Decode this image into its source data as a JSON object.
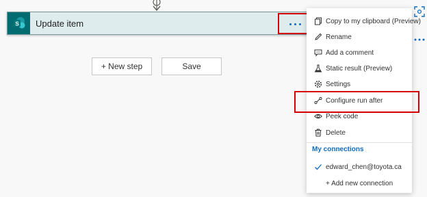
{
  "card": {
    "title": "Update item"
  },
  "buttons": {
    "new_step": "+ New step",
    "save": "Save"
  },
  "menu": {
    "items": [
      {
        "label": "Copy to my clipboard (Preview)",
        "icon": "copy-icon"
      },
      {
        "label": "Rename",
        "icon": "pencil-icon"
      },
      {
        "label": "Add a comment",
        "icon": "comment-icon"
      },
      {
        "label": "Static result (Preview)",
        "icon": "flask-icon"
      },
      {
        "label": "Settings",
        "icon": "gear-icon"
      },
      {
        "label": "Configure run after",
        "icon": "run-after-icon"
      },
      {
        "label": "Peek code",
        "icon": "eye-icon"
      },
      {
        "label": "Delete",
        "icon": "trash-icon"
      }
    ],
    "connections_heading": "My connections",
    "connection": "edward_chen@toyota.ca",
    "add_connection": "+ Add new connection"
  },
  "colors": {
    "accent": "#0f6cbd",
    "highlight": "#d40000",
    "sharepoint": "#036c70",
    "card_bg": "#dfeced"
  }
}
